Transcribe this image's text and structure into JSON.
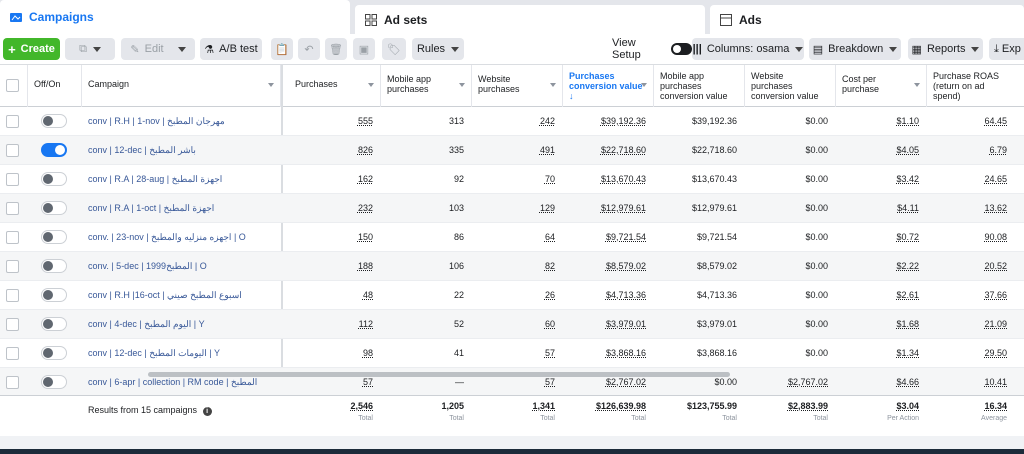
{
  "tabs": [
    {
      "label": "Campaigns",
      "icon": "folder-icon"
    },
    {
      "label": "Ad sets",
      "icon": "grid-icon"
    },
    {
      "label": "Ads",
      "icon": "ad-icon"
    }
  ],
  "toolbar": {
    "create": "Create",
    "edit": "Edit",
    "ab_test": "A/B test",
    "rules": "Rules",
    "view_setup": "View Setup",
    "columns": "Columns: osama",
    "breakdown": "Breakdown",
    "reports": "Reports",
    "export": "Exp"
  },
  "columns": {
    "offon": "Off/On",
    "campaign": "Campaign",
    "purchases": "Purchases",
    "mobile_purchases": "Mobile app purchases",
    "website_purchases": "Website purchases",
    "pcv": "Purchases conversion value",
    "mobile_pcv": "Mobile app purchases conversion value",
    "website_pcv": "Website purchases conversion value",
    "cost": "Cost per purchase",
    "roas": "Purchase ROAS (return on ad spend)"
  },
  "rows": [
    {
      "name": "conv | R.H | 1-nov | مهرجان المطبخ",
      "on": false,
      "purchases": "555",
      "mobile": "313",
      "website": "242",
      "pcv": "$39,192.36",
      "mpcv": "$39,192.36",
      "wpcv": "$0.00",
      "cost": "$1.10",
      "roas": "64.45"
    },
    {
      "name": "conv | 12-dec | باشر المطبخ",
      "on": true,
      "purchases": "826",
      "mobile": "335",
      "website": "491",
      "pcv": "$22,718.60",
      "mpcv": "$22,718.60",
      "wpcv": "$0.00",
      "cost": "$4.05",
      "roas": "6.79"
    },
    {
      "name": "conv | R.A | 28-aug | اجهزة المطبخ",
      "on": false,
      "purchases": "162",
      "mobile": "92",
      "website": "70",
      "pcv": "$13,670.43",
      "mpcv": "$13,670.43",
      "wpcv": "$0.00",
      "cost": "$3.42",
      "roas": "24.65"
    },
    {
      "name": "conv | R.A | 1-oct | اجهزة المطبخ",
      "on": false,
      "purchases": "232",
      "mobile": "103",
      "website": "129",
      "pcv": "$12,979.61",
      "mpcv": "$12,979.61",
      "wpcv": "$0.00",
      "cost": "$4.11",
      "roas": "13.62"
    },
    {
      "name": "conv. | 23-nov | اجهزه منزليه والمطبخ | O",
      "on": false,
      "purchases": "150",
      "mobile": "86",
      "website": "64",
      "pcv": "$9,721.54",
      "mpcv": "$9,721.54",
      "wpcv": "$0.00",
      "cost": "$0.72",
      "roas": "90.08"
    },
    {
      "name": "conv. | 5-dec | 1999المطبخ | O",
      "on": false,
      "purchases": "188",
      "mobile": "106",
      "website": "82",
      "pcv": "$8,579.02",
      "mpcv": "$8,579.02",
      "wpcv": "$0.00",
      "cost": "$2.22",
      "roas": "20.52"
    },
    {
      "name": "conv | R.H |16-oct | اسبوع المطبخ صيني",
      "on": false,
      "purchases": "48",
      "mobile": "22",
      "website": "26",
      "pcv": "$4,713.36",
      "mpcv": "$4,713.36",
      "wpcv": "$0.00",
      "cost": "$2.61",
      "roas": "37.66"
    },
    {
      "name": "conv | 4-dec | اليوم المطبخ | Y",
      "on": false,
      "purchases": "112",
      "mobile": "52",
      "website": "60",
      "pcv": "$3,979.01",
      "mpcv": "$3,979.01",
      "wpcv": "$0.00",
      "cost": "$1.68",
      "roas": "21.09"
    },
    {
      "name": "conv | 12-dec | اليومات المطبخ | Y",
      "on": false,
      "purchases": "98",
      "mobile": "41",
      "website": "57",
      "pcv": "$3,868.16",
      "mpcv": "$3,868.16",
      "wpcv": "$0.00",
      "cost": "$1.34",
      "roas": "29.50"
    },
    {
      "name": "conv | 6-apr | collection | RM code | المطبخ",
      "on": false,
      "purchases": "57",
      "mobile": "—",
      "website": "57",
      "pcv": "$2,767.02",
      "mpcv": "$0.00",
      "wpcv": "$2,767.02",
      "cost": "$4.66",
      "roas": "10.41"
    }
  ],
  "totals": {
    "label": "Results from 15 campaigns",
    "purchases": "2,546",
    "purchases_l": "Total",
    "mobile": "1,205",
    "mobile_l": "Total",
    "website": "1,341",
    "website_l": "Total",
    "pcv": "$126,639.98",
    "pcv_l": "Total",
    "mpcv": "$123,755.99",
    "mpcv_l": "Total",
    "wpcv": "$2,883.99",
    "wpcv_l": "Total",
    "cost": "$3.04",
    "cost_l": "Per Action",
    "roas": "16.34",
    "roas_l": "Average"
  }
}
